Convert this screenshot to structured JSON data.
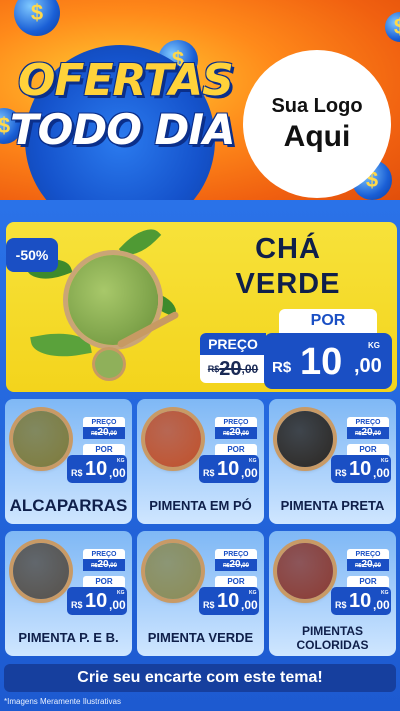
{
  "header": {
    "title_line1": "OFERTAS",
    "title_line2": "TODO DIA",
    "coin_symbol": "$",
    "logo_line1": "Sua Logo",
    "logo_line2": "Aqui"
  },
  "hero": {
    "discount": "-50%",
    "name_line1": "CHÁ",
    "name_line2": "VERDE",
    "old_label": "PREÇO",
    "old_currency": "R$",
    "old_int": "20",
    "old_dec": ",00",
    "new_label": "POR",
    "new_currency": "R$",
    "new_int": "10",
    "new_dec": ",00",
    "unit": "KG"
  },
  "products": [
    {
      "name": "ALCAPARRAS",
      "old_label": "PREÇO",
      "old_currency": "R$",
      "old_int": "20",
      "old_dec": ",00",
      "new_label": "POR",
      "new_currency": "R$",
      "new_int": "10",
      "new_dec": ",00",
      "unit": "KG",
      "color": "#7d7a3a"
    },
    {
      "name": "PIMENTA EM PÓ",
      "old_label": "PREÇO",
      "old_currency": "R$",
      "old_int": "20",
      "old_dec": ",00",
      "new_label": "POR",
      "new_currency": "R$",
      "new_int": "10",
      "new_dec": ",00",
      "unit": "KG",
      "color": "#c0502a"
    },
    {
      "name": "PIMENTA PRETA",
      "old_label": "PREÇO",
      "old_currency": "R$",
      "old_int": "20",
      "old_dec": ",00",
      "new_label": "POR",
      "new_currency": "R$",
      "new_int": "10",
      "new_dec": ",00",
      "unit": "KG",
      "color": "#2a2622"
    },
    {
      "name": "PIMENTA P. E B.",
      "old_label": "PREÇO",
      "old_currency": "R$",
      "old_int": "20",
      "old_dec": ",00",
      "new_label": "POR",
      "new_currency": "R$",
      "new_int": "10",
      "new_dec": ",00",
      "unit": "KG",
      "color": "#55504a"
    },
    {
      "name": "PIMENTA VERDE",
      "old_label": "PREÇO",
      "old_currency": "R$",
      "old_int": "20",
      "old_dec": ",00",
      "new_label": "POR",
      "new_currency": "R$",
      "new_int": "10",
      "new_dec": ",00",
      "unit": "KG",
      "color": "#8a8b55"
    },
    {
      "name_line1": "PIMENTAS",
      "name_line2": "COLORIDAS",
      "old_label": "PREÇO",
      "old_currency": "R$",
      "old_int": "20",
      "old_dec": ",00",
      "new_label": "POR",
      "new_currency": "R$",
      "new_int": "10",
      "new_dec": ",00",
      "unit": "KG",
      "color": "#8a3a32"
    }
  ],
  "footer": {
    "cta": "Crie seu encarte com este tema!",
    "disclaimer": "*Imagens Meramente Ilustrativas"
  },
  "colors": {
    "accent_blue": "#1a4fc4",
    "hero_yellow": "#f3d41c",
    "header_orange": "#f06010"
  }
}
